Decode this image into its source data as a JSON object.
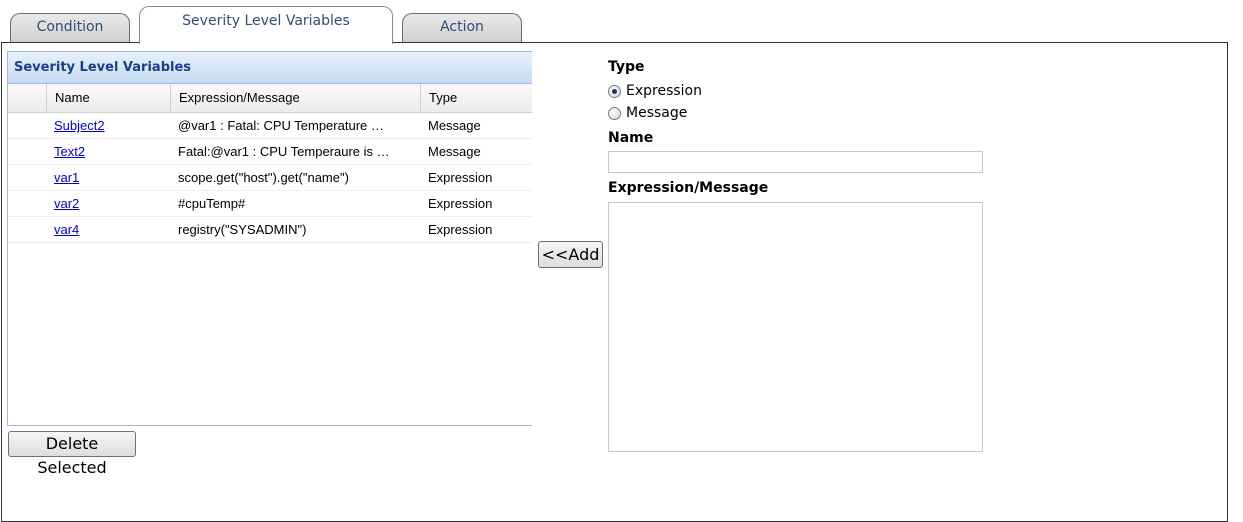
{
  "tabs": [
    {
      "label": "Condition"
    },
    {
      "label": "Severity Level Variables"
    },
    {
      "label": "Action"
    }
  ],
  "grid": {
    "title": "Severity Level Variables",
    "columns": {
      "name": "Name",
      "expression": "Expression/Message",
      "type": "Type"
    },
    "rows": [
      {
        "name": "Subject2",
        "expression": "@var1 : Fatal: CPU Temperature …",
        "type": "Message"
      },
      {
        "name": "Text2",
        "expression": "Fatal:@var1 : CPU Temperaure is …",
        "type": "Message"
      },
      {
        "name": "var1",
        "expression": "scope.get(\"host\").get(\"name\")",
        "type": "Expression"
      },
      {
        "name": "var2",
        "expression": "#cpuTemp#",
        "type": "Expression"
      },
      {
        "name": "var4",
        "expression": "registry(\"SYSADMIN\")",
        "type": "Expression"
      }
    ]
  },
  "buttons": {
    "delete": "Delete Selected",
    "add": "<<Add"
  },
  "form": {
    "type_label": "Type",
    "options": [
      {
        "label": "Expression",
        "selected": true
      },
      {
        "label": "Message",
        "selected": false
      }
    ],
    "name_label": "Name",
    "name_value": "",
    "expr_label": "Expression/Message",
    "expr_value": ""
  }
}
